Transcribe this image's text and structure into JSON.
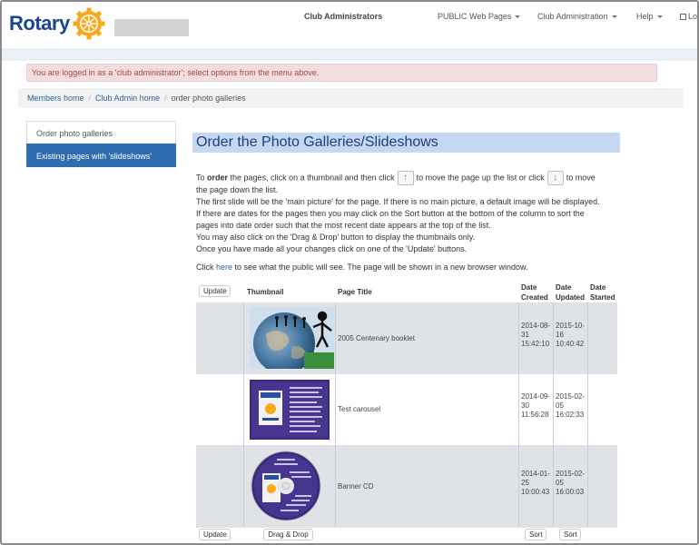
{
  "brand": {
    "name": "Rotary"
  },
  "nav": {
    "club_admins": "Club Administrators",
    "public_pages": "PUBLIC Web Pages",
    "club_admin": "Club Administration",
    "help": "Help",
    "logout": "Lo"
  },
  "alert": "You are logged in as a 'club administrator'; select options from the menu above.",
  "breadcrumb": [
    "Members home",
    "Club Admin home",
    "order photo galleries"
  ],
  "side_menu": {
    "items": [
      "Order photo galleries",
      "Existing pages with 'slideshows'"
    ]
  },
  "main": {
    "title": "Order the Photo Galleries/Slideshows",
    "para1_a": "To ",
    "para1_b": "order",
    "para1_c": " the pages, click on a thumbnail and then click",
    "para1_d": "to move the page up the list or click",
    "para1_e": "to move",
    "para2": "the page down the list.",
    "para3": "The first slide will be the 'main picture' for the page. If there is no main picture, a default image will be displayed.",
    "para4": "If there are dates for the pages then you may click on the Sort button at the bottom of the column to sort the",
    "para5": "pages into date order such that the most recent date appears at the top of the list.",
    "para6": "You may also click on the 'Drag & Drop' button to display the thumbnails only.",
    "para7": "Once you have made all your changes click on one of the 'Update' buttons.",
    "click_a": "Click ",
    "click_link": "here",
    "click_b": " to see what the public will see. The page will be shown in a new browser window."
  },
  "table": {
    "update_label": "Update",
    "dragdrop_label": "Drag & Drop",
    "sort_label": "Sort",
    "headers": {
      "thumbnail": "Thumbnail",
      "page_title": "Page Title",
      "date_created": [
        "Date",
        "Created"
      ],
      "date_updated": [
        "Date",
        "Updated"
      ],
      "date_started": [
        "Date",
        "Started"
      ]
    },
    "rows": [
      {
        "title": "2005 Centenary booklet",
        "created": [
          "2014-08-",
          "31",
          "15:42:10"
        ],
        "updated": [
          "2015-10-",
          "16",
          "10:40:42"
        ]
      },
      {
        "title": "Test carousel",
        "created": [
          "2014-09-",
          "30",
          "11:56:28"
        ],
        "updated": [
          "2015-02-",
          "05",
          "16:02:33"
        ]
      },
      {
        "title": "Banner CD",
        "created": [
          "2014-01-",
          "25",
          "10:00:43"
        ],
        "updated": [
          "2015-02-",
          "05",
          "16:00:03"
        ]
      }
    ]
  },
  "colors": {
    "brand_blue": "#17458f",
    "brand_gold": "#f7a81b",
    "active_blue": "#2f6db2",
    "alert_bg": "#f2dede",
    "title_bg": "#c6d7f2"
  }
}
